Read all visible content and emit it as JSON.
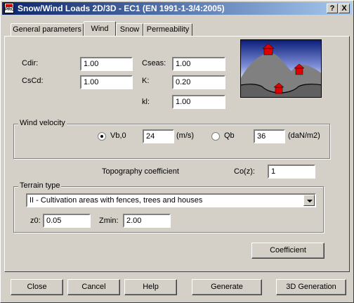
{
  "window": {
    "title": "Snow/Wind Loads 2D/3D - EC1 (EN 1991-1-3/4:2005)",
    "icon_text": "PRO"
  },
  "title_buttons": {
    "help": "?",
    "close": "X"
  },
  "tabs": [
    {
      "label": "General parameters"
    },
    {
      "label": "Wind",
      "active": true
    },
    {
      "label": "Snow"
    },
    {
      "label": "Permeability"
    }
  ],
  "params": {
    "cdir_label": "Cdir:",
    "cdir_value": "1.00",
    "cscd_label": "CsCd:",
    "cscd_value": "1.00",
    "cseas_label": "Cseas:",
    "cseas_value": "1.00",
    "k_label": "K:",
    "k_value": "0.20",
    "kl_label": "kl:",
    "kl_value": "1.00"
  },
  "wind_velocity": {
    "title": "Wind velocity",
    "vb0_label": "Vb,0",
    "vb0_value": "24",
    "vb0_unit": "(m/s)",
    "vb0_selected": true,
    "qb_label": "Qb",
    "qb_value": "36",
    "qb_unit": "(daN/m2)"
  },
  "topography": {
    "label": "Topography coefficient",
    "co_label": "Co(z):",
    "co_value": "1"
  },
  "terrain": {
    "title": "Terrain type",
    "selected": "II - Cultivation areas with fences, trees and houses",
    "z0_label": "z0:",
    "z0_value": "0.05",
    "zmin_label": "Zmin:",
    "zmin_value": "2.00"
  },
  "coefficient_button": "Coefficient",
  "footer": {
    "close": "Close",
    "cancel": "Cancel",
    "help": "Help",
    "generate": "Generate",
    "generation_3d": "3D Generation"
  },
  "colors": {
    "titlebar_start": "#0a246a",
    "titlebar_end": "#a6caf0",
    "house_red": "#e00000",
    "terrain_gray": "#808080"
  }
}
